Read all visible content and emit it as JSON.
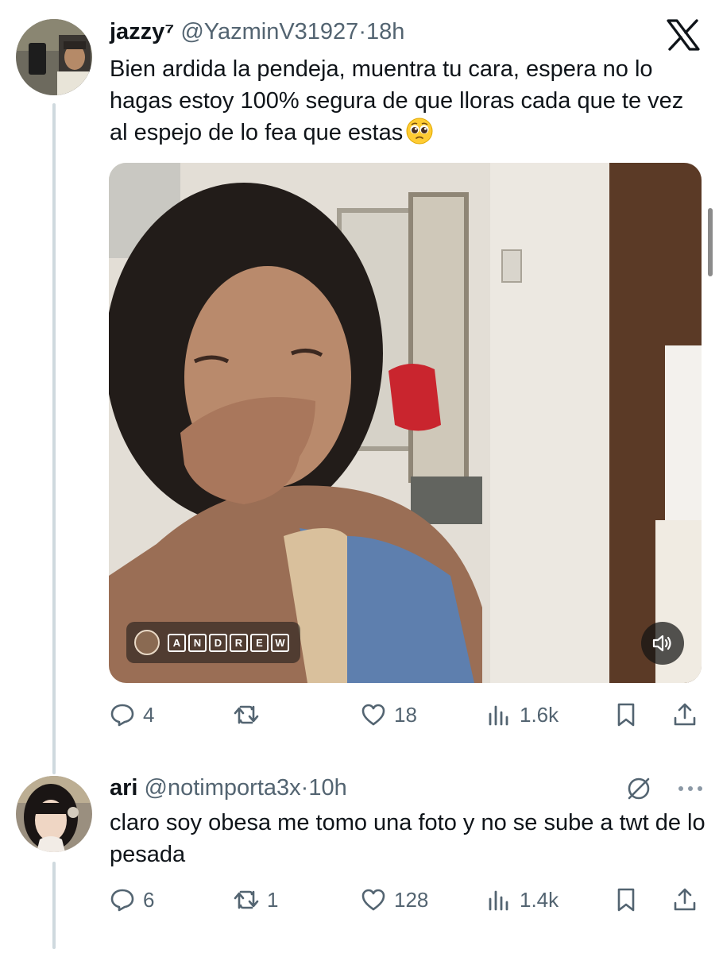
{
  "tweet1": {
    "name": "jazzy⁷",
    "handle": "@YazminV31927",
    "separator": "·",
    "time": "18h",
    "text": "Bien ardida la pendeja, muentra tu cara, espera no lo hagas estoy 100% segura de que lloras cada que te vez al espejo de lo fea que estas",
    "emoji_icon": "pleading-face-emoji",
    "watermark_letters": [
      "A",
      "N",
      "D",
      "R",
      "E",
      "W"
    ],
    "actions": {
      "replies": "4",
      "retweets": "",
      "likes": "18",
      "views": "1.6k"
    }
  },
  "tweet2": {
    "name": "ari",
    "handle": "@notimporta3x",
    "separator": "·",
    "time": "10h",
    "text": "claro soy obesa me tomo una foto y no se sube a twt de lo pesada",
    "actions": {
      "replies": "6",
      "retweets": "1",
      "likes": "128",
      "views": "1.4k"
    }
  },
  "icons": {
    "logo": "x-logo-icon",
    "reply": "reply-icon",
    "retweet": "retweet-icon",
    "like": "heart-icon",
    "views": "views-icon",
    "bookmark": "bookmark-icon",
    "share": "share-icon",
    "sound": "speaker-icon",
    "muted_badge": "slashed-circle-icon",
    "more": "more-dots-icon"
  },
  "colors": {
    "text": "#0f1419",
    "secondary": "#536471",
    "thread_line": "#cfd9de"
  }
}
